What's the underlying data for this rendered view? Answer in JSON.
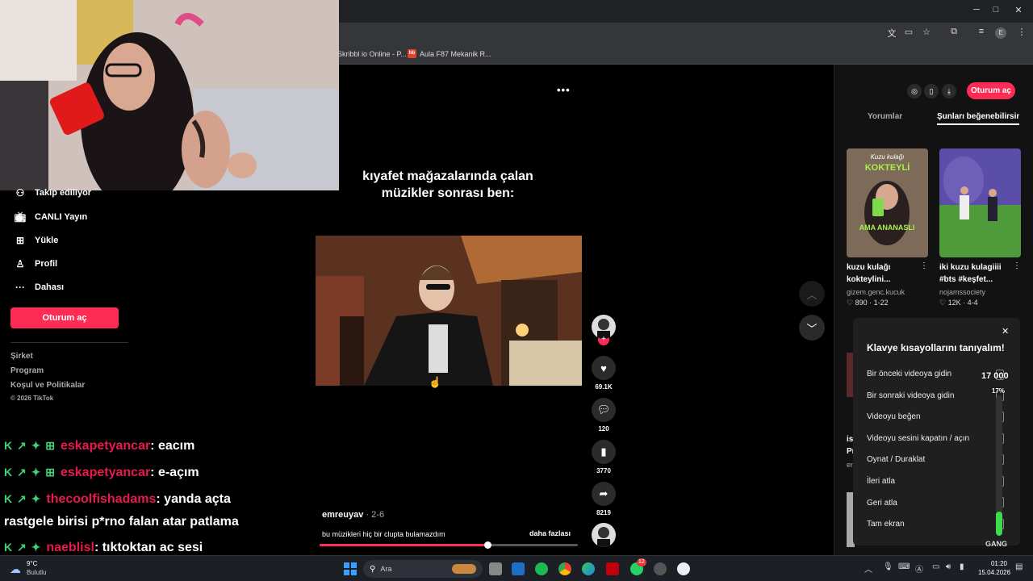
{
  "bookmarks": [
    {
      "label": "Skribbl io Online - P..."
    },
    {
      "label": "Aula F87 Mekanik R...",
      "badge": "hb"
    }
  ],
  "tiktok": {
    "sidebar": {
      "items": [
        {
          "label": "Takip ediliyor",
          "icon": "following-icon"
        },
        {
          "label": "CANLI Yayın",
          "icon": "live-icon"
        },
        {
          "label": "Yükle",
          "icon": "upload-icon"
        },
        {
          "label": "Profil",
          "icon": "profile-icon"
        },
        {
          "label": "Dahası",
          "icon": "more-icon"
        }
      ],
      "login_label": "Oturum aç",
      "footer": [
        "Şirket",
        "Program",
        "Koşul ve Politikalar"
      ],
      "copyright": "© 2026 TikTok"
    },
    "video": {
      "caption_line1": "kıyafet mağazalarında çalan",
      "caption_line2": "müzikler sonrası ben:",
      "author": "emreuyav",
      "date": "2-6",
      "description": "bu müzikleri hiç bir clupta bulamazdım",
      "more_label": "daha fazlası",
      "progress": 0.65,
      "menu_icon": "•••"
    },
    "actions": {
      "likes": "69.1K",
      "comments": "120",
      "saves": "3770",
      "shares": "8219"
    },
    "right_panel": {
      "login_label": "Oturum aç",
      "tabs": [
        "Yorumlar",
        "Şunları beğenebilirsin"
      ],
      "cards": [
        {
          "title_line1": "kuzu kulağı",
          "title_line2": "kokteylini...",
          "user": "gizem.genc.kucuk",
          "likes": "890",
          "date": "1-22",
          "thumb_text_top": "Kuzu kulağı",
          "thumb_text_mid": "KOKTEYLİ",
          "thumb_text_bottom": "AMA ANANASLI"
        },
        {
          "title_line1": "iki kuzu kulagiiii",
          "title_line2": "#bts #keşfet...",
          "user": "nojamssociety",
          "likes": "12K",
          "date": "4-4"
        }
      ],
      "peek_texts": [
        "is",
        "Pr",
        "en"
      ]
    },
    "shortcuts": {
      "title": "Klavye kısayollarını tanıyalım!",
      "items": [
        "Bir önceki videoya gidin",
        "Bir sonraki videoya gidin",
        "Videoyu beğen",
        "Videoyu sesini kapatın / açın",
        "Oynat / Duraklat",
        "İleri atla",
        "Geri atla",
        "Tam ekran"
      ]
    }
  },
  "stream_overlay": {
    "meter_value": "17 000",
    "meter_percent": "17%",
    "meter_label": "GANG"
  },
  "chat": [
    {
      "badges": "K ↗ ✦ ⊞",
      "user": "eskapetyancar",
      "message": ": eacım"
    },
    {
      "badges": "K ↗ ✦ ⊞",
      "user": "eskapetyancar",
      "message": ": e-açım"
    },
    {
      "badges": "K ↗ ✦",
      "user": "thecoolfishadams",
      "message": ": yanda açta"
    },
    {
      "badges": "",
      "user": "",
      "message": "rastgele birisi p*rno falan atar patlama"
    },
    {
      "badges": "K ↗ ✦",
      "user": "naeblisl",
      "message": ": tıktoktan ac sesi"
    }
  ],
  "taskbar": {
    "weather_temp": "9°C",
    "weather_desc": "Bulutlu",
    "search_placeholder": "Ara",
    "time": "01:20",
    "date": "15.04.2026",
    "whatsapp_badge": "12"
  },
  "colors": {
    "tiktok_red": "#fe2c55",
    "chat_user": "#e8194c",
    "chat_badge": "#3fd17a",
    "meter_green": "#3ddc4f"
  }
}
